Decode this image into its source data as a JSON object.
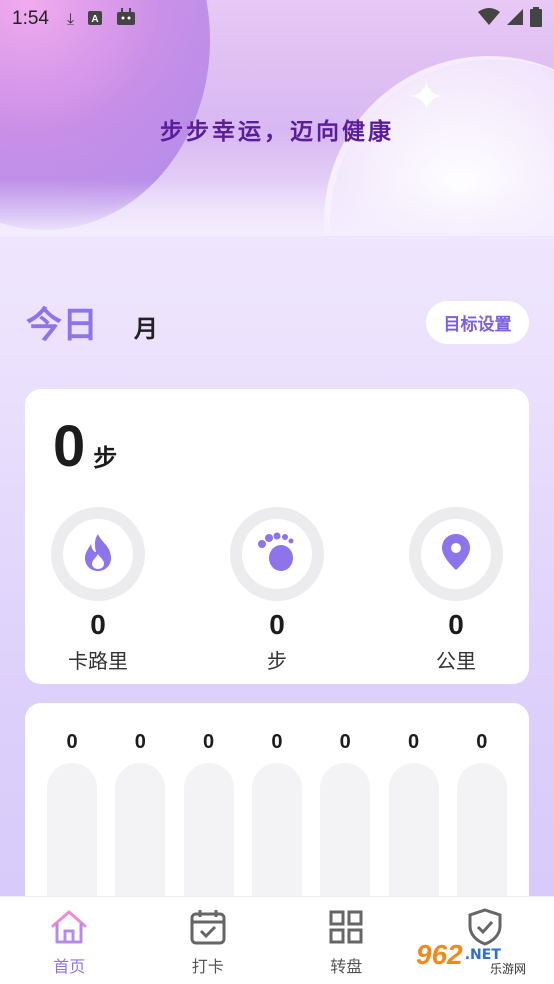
{
  "status_bar": {
    "time": "1:54",
    "icons": [
      "download-icon",
      "a-app-icon",
      "android-icon"
    ],
    "right_icons": [
      "wifi-icon",
      "signal-icon",
      "battery-icon"
    ]
  },
  "header": {
    "slogan": "步步幸运，迈向健康"
  },
  "tabs": {
    "today": "今日",
    "month": "月"
  },
  "goal_button": "目标设置",
  "summary": {
    "steps_value": "0",
    "steps_unit": "步",
    "metrics": [
      {
        "icon": "fire-icon",
        "value": "0",
        "label": "卡路里"
      },
      {
        "icon": "footprint-icon",
        "value": "0",
        "label": "步"
      },
      {
        "icon": "location-pin-icon",
        "value": "0",
        "label": "公里"
      }
    ]
  },
  "chart_data": {
    "type": "bar",
    "values": [
      0,
      0,
      0,
      0,
      0,
      0,
      0
    ]
  },
  "bottom_nav": {
    "items": [
      {
        "label": "首页",
        "icon": "home-icon",
        "active": true
      },
      {
        "label": "打卡",
        "icon": "calendar-check-icon",
        "active": false
      },
      {
        "label": "转盘",
        "icon": "grid-icon",
        "active": false
      },
      {
        "label": "",
        "icon": "shield-check-icon",
        "active": false
      }
    ]
  },
  "watermark": {
    "logo": "962",
    "domain": ".NET",
    "sub": "乐游网"
  },
  "colors": {
    "accent": "#8d74ea",
    "slogan": "#5a1e9a"
  }
}
